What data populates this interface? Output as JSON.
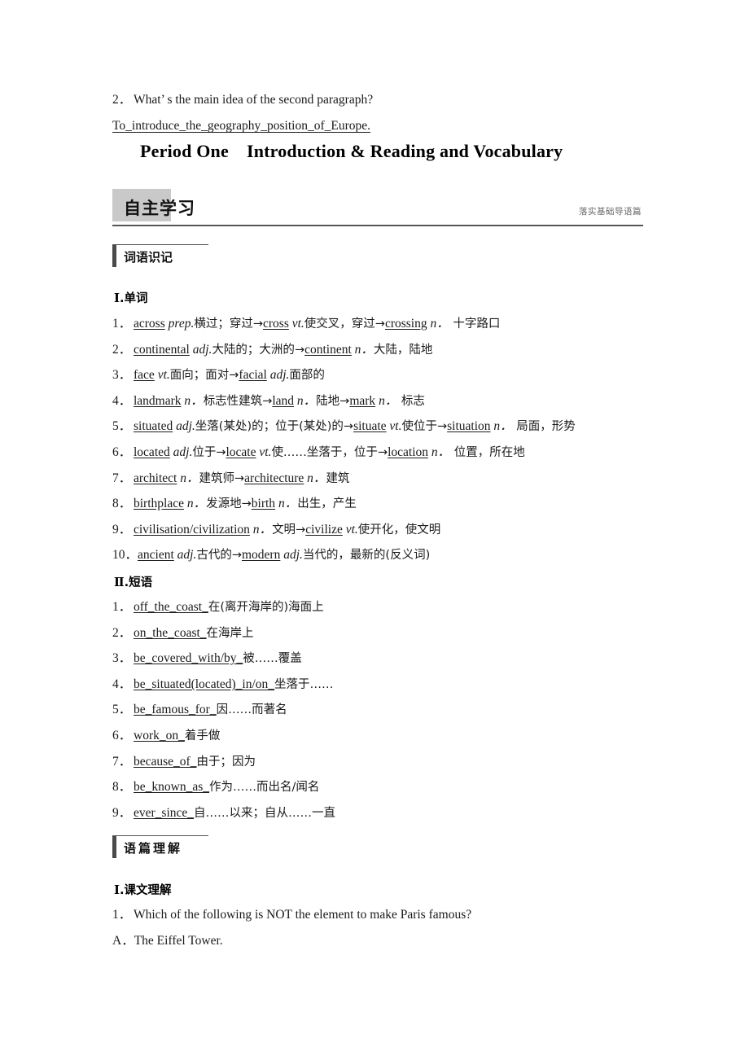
{
  "top_question": {
    "number": "2．",
    "text": "What’ s the main idea of the second paragraph?",
    "answer": "To_introduce_the_geography_position_of_Europe."
  },
  "period_title": {
    "period": "Period One",
    "subject": "Introduction & Reading and Vocabulary"
  },
  "banner": {
    "title": "自主学习",
    "subtitle": "落实基础导语篇"
  },
  "section_words": {
    "header": "词语识记",
    "group_roman": "Ⅰ",
    "group_label": ".单词",
    "items": [
      {
        "number": "1．",
        "word": "across",
        "pos": "prep.",
        "def": "横过；穿过",
        "arrow1": "→",
        "word2": "cross",
        "pos2": "vt.",
        "def2": "使交叉，穿过",
        "arrow2": "→",
        "word3": "crossing",
        "pos3": "n．",
        "def3": "十字路口"
      },
      {
        "number": "2．",
        "word": "continental",
        "pos": "adj.",
        "def": "大陆的；大洲的",
        "arrow1": "→",
        "word2": "continent",
        "pos2": "n．",
        "def2": "大陆，陆地"
      },
      {
        "number": "3．",
        "word": "face",
        "pos": "vt.",
        "def": "面向；面对",
        "arrow1": "→",
        "word2": "facial",
        "pos2": "adj.",
        "def2": "面部的"
      },
      {
        "number": "4．",
        "word": "landmark",
        "pos": "n．",
        "def": "标志性建筑",
        "arrow1": "→",
        "word2": "land",
        "pos2": "n．",
        "def2": "陆地",
        "arrow2": "→",
        "word3": "mark",
        "pos3": "n．",
        "def3": "标志"
      },
      {
        "number": "5．",
        "word": "situated",
        "pos": "adj.",
        "def": "坐落(某处)的；位于(某处)的",
        "arrow1": "→",
        "word2": "situate",
        "pos2": "vt.",
        "def2": "使位于",
        "arrow2": "→",
        "word3": "situation",
        "pos3": "n．",
        "def3": "局面，形势"
      },
      {
        "number": "6．",
        "word": "located",
        "pos": "adj.",
        "def": "位于",
        "arrow1": "→",
        "word2": "locate",
        "pos2": "vt.",
        "def2": "使……坐落于，位于",
        "arrow2": "→",
        "word3": "location",
        "pos3": "n．",
        "def3": "位置，所在地"
      },
      {
        "number": "7．",
        "word": "architect",
        "pos": "n．",
        "def": "建筑师",
        "arrow1": "→",
        "word2": "architecture",
        "pos2": "n．",
        "def2": "建筑"
      },
      {
        "number": "8．",
        "word": "birthplace",
        "pos": "n．",
        "def": "发源地",
        "arrow1": "→",
        "word2": "birth",
        "pos2": "n．",
        "def2": "出生，产生"
      },
      {
        "number": "9．",
        "word": "civilisation/civilization",
        "pos": "n．",
        "def": "文明",
        "arrow1": "→",
        "word2": "civilize",
        "pos2": "vt.",
        "def2": "使开化，使文明"
      },
      {
        "number": "10．",
        "word": "ancient",
        "pos": "adj.",
        "def": "古代的",
        "arrow1": "→",
        "word2": "modern",
        "pos2": "adj.",
        "def2": "当代的，最新的(反义词)"
      }
    ]
  },
  "section_phrases": {
    "group_roman": "Ⅱ",
    "group_label": ".短语",
    "items": [
      {
        "number": "1．",
        "phrase": "off_the_coast_",
        "def": "在(离开海岸的)海面上"
      },
      {
        "number": "2．",
        "phrase": "on_the_coast_",
        "def": "在海岸上"
      },
      {
        "number": "3．",
        "phrase": "be_covered_with/by_",
        "def": "被……覆盖"
      },
      {
        "number": "4．",
        "phrase": "be_situated(located)_in/on_",
        "def": "坐落于……"
      },
      {
        "number": "5．",
        "phrase": "be_famous_for_",
        "def": "因……而著名"
      },
      {
        "number": "6．",
        "phrase": "work_on_",
        "def": "着手做"
      },
      {
        "number": "7．",
        "phrase": "because_of_",
        "def": "由于；因为"
      },
      {
        "number": "8．",
        "phrase": "be_known_as_",
        "def": "作为……而出名/闻名"
      },
      {
        "number": "9．",
        "phrase": "ever_since_",
        "def": "自……以来；自从……一直"
      }
    ]
  },
  "section_reading": {
    "header": "语篇理解",
    "group_roman": "Ⅰ",
    "group_label": ".课文理解",
    "question": {
      "number": "1．",
      "text": "Which of the following is NOT the element to make Paris famous?"
    },
    "option": {
      "letter": "A．",
      "text": "The Eiffel Tower."
    }
  }
}
